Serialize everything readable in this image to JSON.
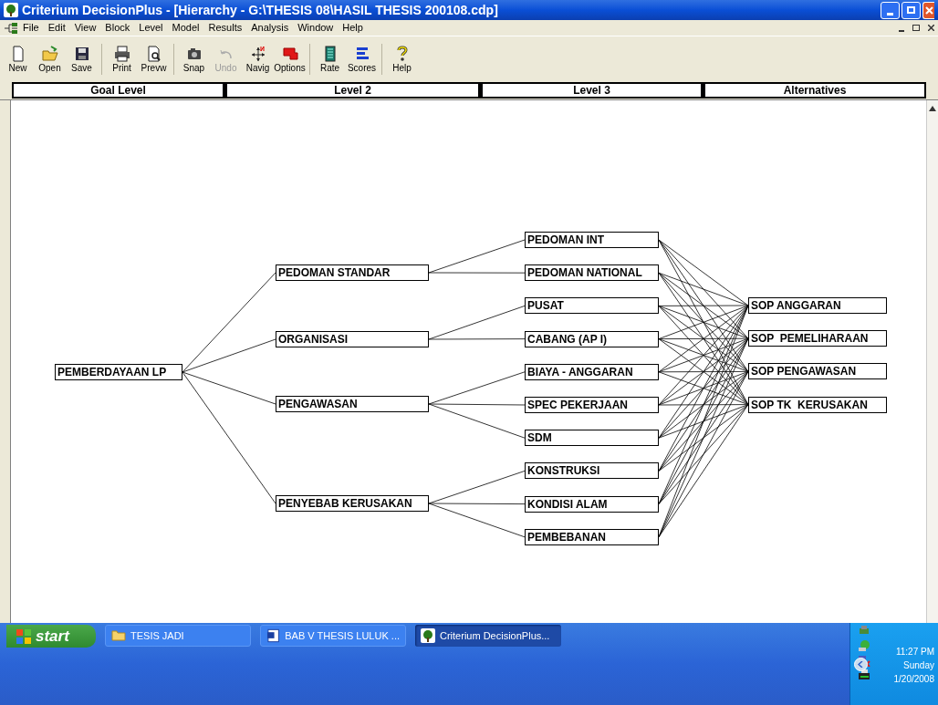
{
  "window": {
    "title": "Criterium DecisionPlus - [Hierarchy - G:\\THESIS 08\\HASIL THESIS 200108.cdp]"
  },
  "menu": [
    "File",
    "Edit",
    "View",
    "Block",
    "Level",
    "Model",
    "Results",
    "Analysis",
    "Window",
    "Help"
  ],
  "toolbar": [
    {
      "label": "New",
      "kind": "new",
      "disabled": false
    },
    {
      "label": "Open",
      "kind": "open",
      "disabled": false
    },
    {
      "label": "Save",
      "kind": "save",
      "disabled": false
    },
    {
      "label": "Print",
      "kind": "print",
      "disabled": false
    },
    {
      "label": "Prevw",
      "kind": "preview",
      "disabled": false
    },
    {
      "label": "Snap",
      "kind": "snap",
      "disabled": false
    },
    {
      "label": "Undo",
      "kind": "undo",
      "disabled": true
    },
    {
      "label": "Navig",
      "kind": "navig",
      "disabled": false
    },
    {
      "label": "Options",
      "kind": "options",
      "disabled": false
    },
    {
      "label": "Rate",
      "kind": "rate",
      "disabled": false
    },
    {
      "label": "Scores",
      "kind": "scores",
      "disabled": false
    },
    {
      "label": "Help",
      "kind": "help",
      "disabled": false
    }
  ],
  "levels": [
    "Goal Level",
    "Level 2",
    "Level 3",
    "Alternatives"
  ],
  "hierarchy": {
    "label": "PEMBERDAYAAN LP",
    "children": [
      {
        "label": "PEDOMAN STANDAR",
        "children": [
          {
            "label": "PEDOMAN INT"
          },
          {
            "label": "PEDOMAN NATIONAL"
          }
        ]
      },
      {
        "label": "ORGANISASI",
        "children": [
          {
            "label": "PUSAT"
          },
          {
            "label": "CABANG (AP I)"
          }
        ]
      },
      {
        "label": "PENGAWASAN",
        "children": [
          {
            "label": "BIAYA - ANGGARAN"
          },
          {
            "label": "SPEC PEKERJAAN"
          },
          {
            "label": "SDM"
          }
        ]
      },
      {
        "label": "PENYEBAB KERUSAKAN",
        "children": [
          {
            "label": "KONSTRUKSI"
          },
          {
            "label": "KONDISI ALAM"
          },
          {
            "label": "PEMBEBANAN"
          }
        ]
      }
    ]
  },
  "alternatives": [
    "SOP ANGGARAN",
    "SOP  PEMELIHARAAN",
    "SOP PENGAWASAN",
    "SOP TK  KERUSAKAN"
  ],
  "taskbar": {
    "start": "start",
    "tasks": [
      {
        "label": "TESIS JADI",
        "kind": "folder",
        "selected": false
      },
      {
        "label": "BAB V THESIS LULUK ...",
        "kind": "word",
        "selected": false
      },
      {
        "label": "Criterium DecisionPlus...",
        "kind": "app",
        "selected": true
      }
    ],
    "clock": {
      "time": "11:27 PM",
      "day": "Sunday",
      "date": "1/20/2008"
    }
  }
}
